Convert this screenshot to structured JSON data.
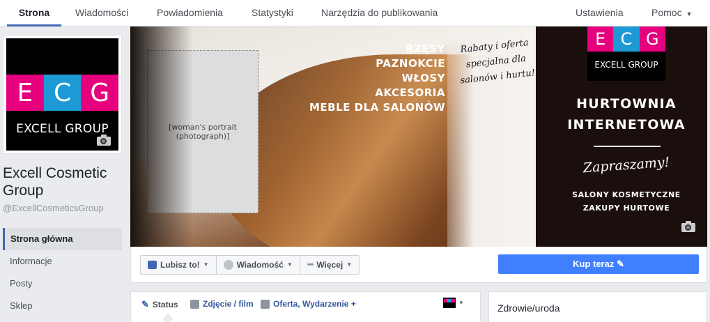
{
  "nav": {
    "tabs": [
      {
        "label": "Strona",
        "active": true
      },
      {
        "label": "Wiadomości"
      },
      {
        "label": "Powiadomienia"
      },
      {
        "label": "Statystyki"
      },
      {
        "label": "Narzędzia do publikowania"
      }
    ],
    "settings": "Ustawienia",
    "help": "Pomoc"
  },
  "logo": {
    "letters": [
      "E",
      "C",
      "G"
    ],
    "colors": [
      "#e6007e",
      "#1d9ad6",
      "#e6007e"
    ],
    "name": "EXCELL GROUP"
  },
  "page": {
    "name": "Excell Cosmetic Group",
    "handle": "@ExcellCosmeticsGroup"
  },
  "sidebar": {
    "items": [
      {
        "label": "Strona główna",
        "active": true
      },
      {
        "label": "Informacje"
      },
      {
        "label": "Posty"
      },
      {
        "label": "Sklep"
      }
    ]
  },
  "cover": {
    "categories": [
      "RZĘSY",
      "PAZNOKCIE",
      "WŁOSY",
      "AKCESORIA",
      "MEBLE DLA SALONÓW"
    ],
    "promo": "Rabaty i oferta specjalna dla salonów i hurtu!",
    "logo_name": "EXCELL GROUP",
    "headline_1": "HURTOWNIA",
    "headline_2": "INTERNETOWA",
    "invite": "Zapraszamy!",
    "sub_1": "SALONY KOSMETYCZNE",
    "sub_2": "ZAKUPY HURTOWE"
  },
  "actions": {
    "like": "Lubisz to!",
    "message": "Wiadomość",
    "more": "Więcej",
    "buy": "Kup teraz"
  },
  "composer": {
    "status": "Status",
    "photo": "Zdjęcie / film",
    "offer": "Oferta, Wydarzenie +"
  },
  "category_card": {
    "label": "Zdrowie/uroda"
  },
  "colors": {
    "accent": "#4267b2",
    "buy_button": "#4080ff",
    "magenta": "#e6007e",
    "cyan": "#1d9ad6"
  }
}
